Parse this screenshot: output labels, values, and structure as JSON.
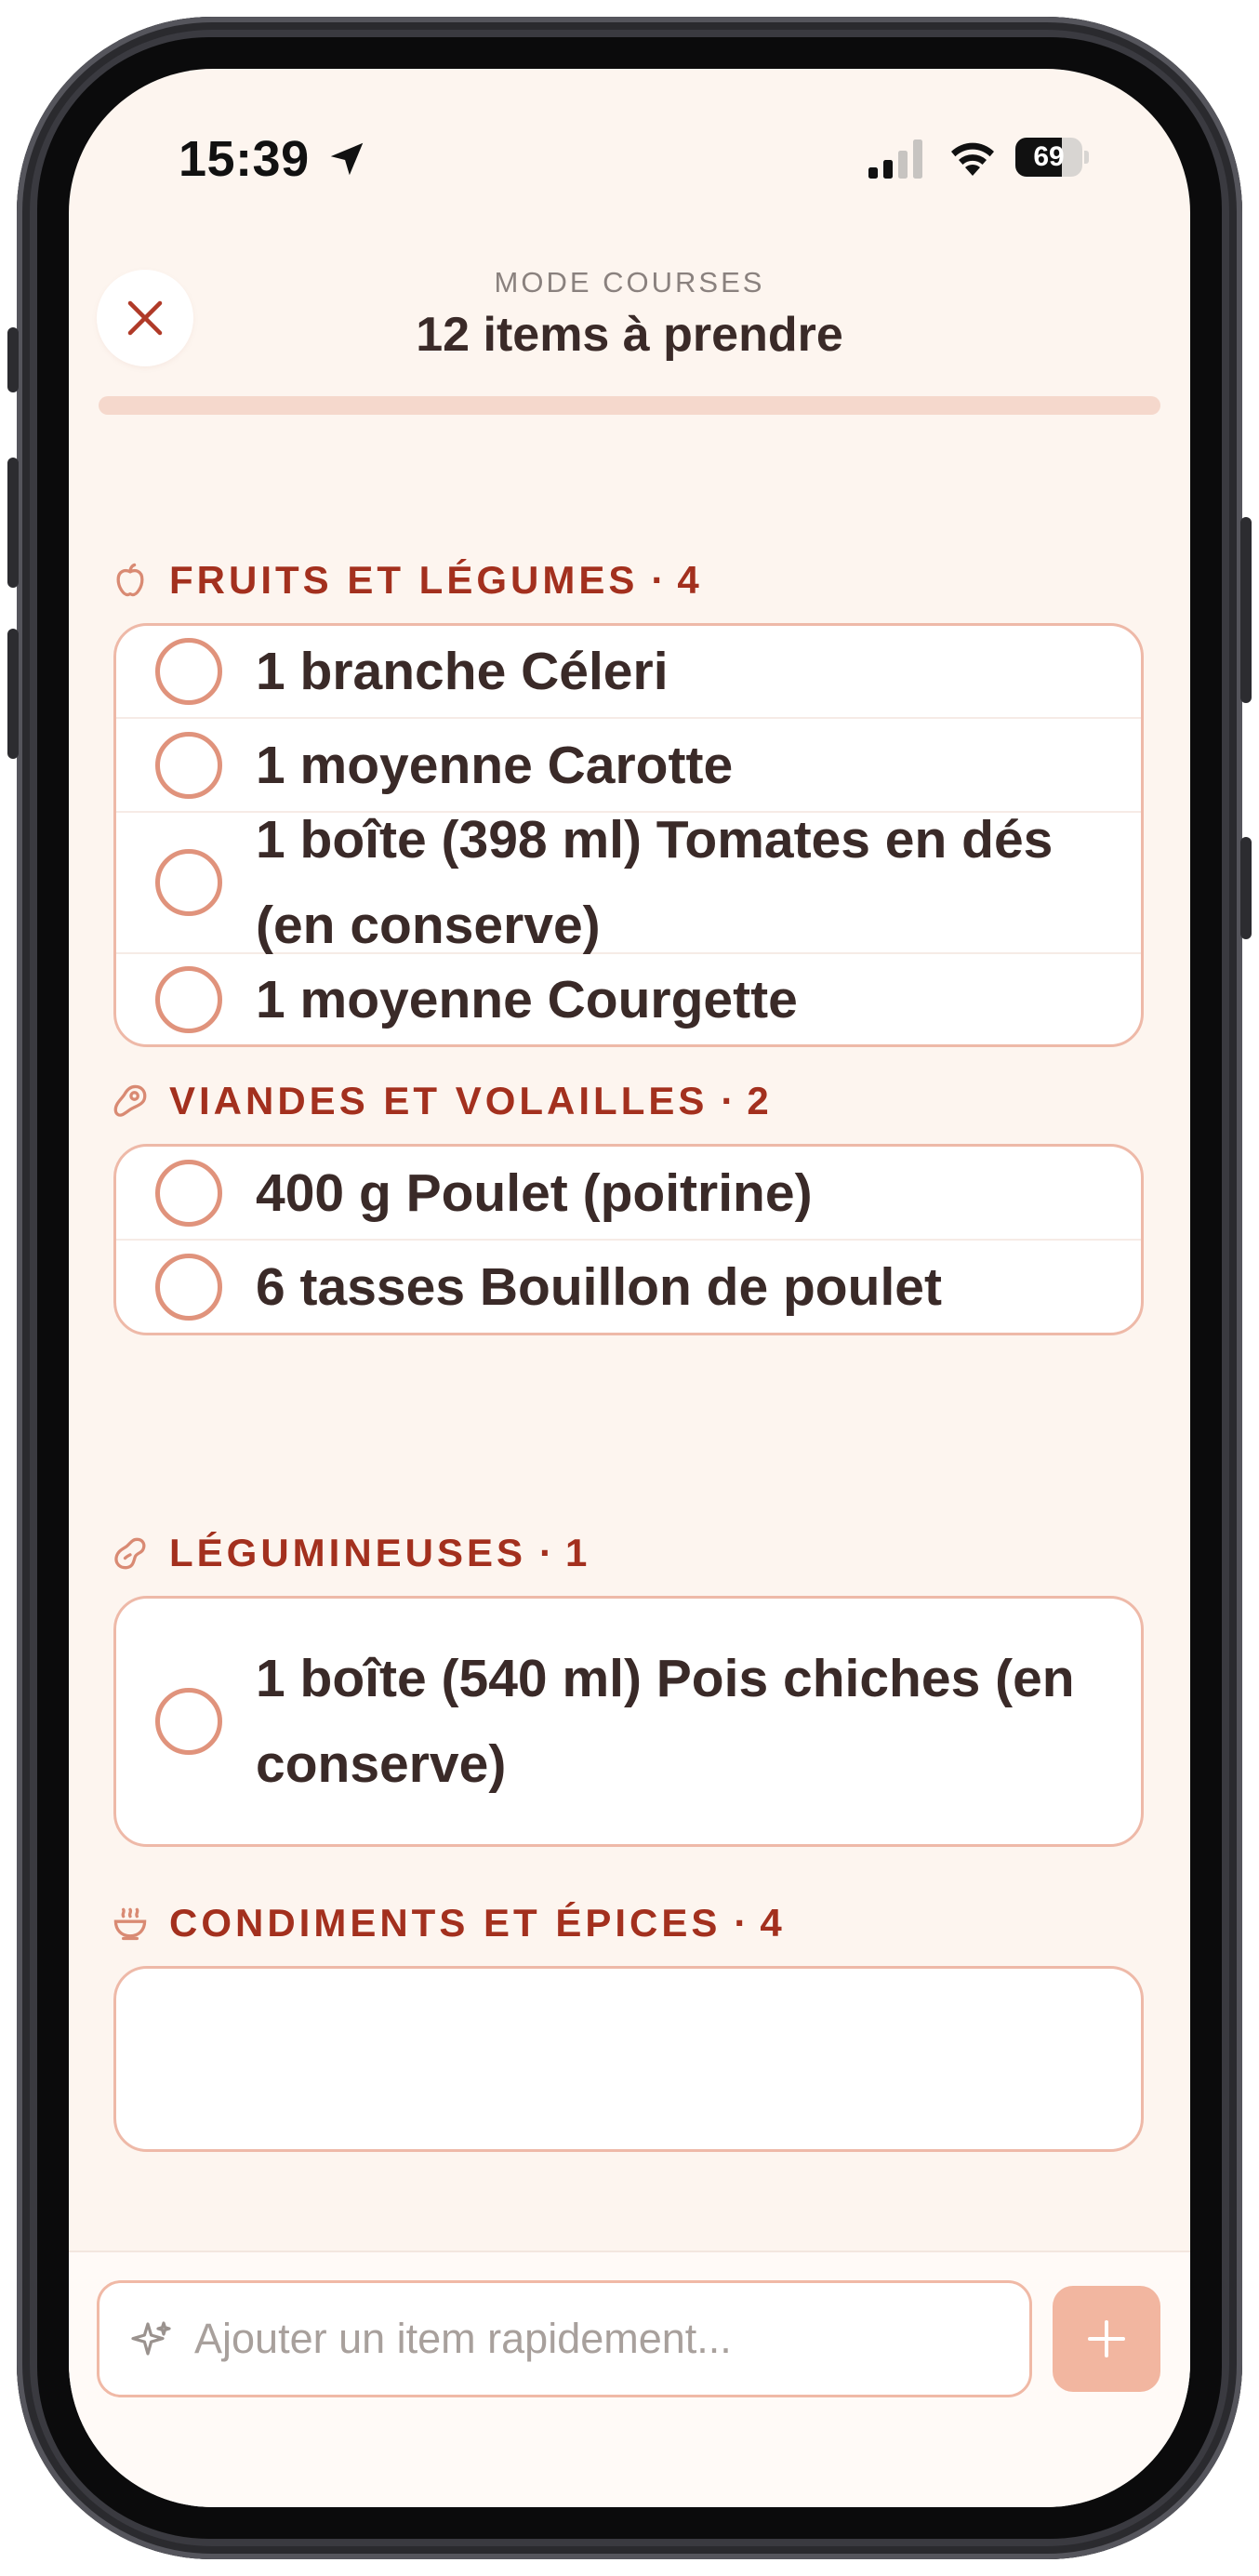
{
  "status_bar": {
    "time": "15:39",
    "battery": "69",
    "battery_level": 0.69,
    "icons": [
      "location-arrow-icon",
      "signal-icon",
      "wifi-icon",
      "battery-icon"
    ]
  },
  "header": {
    "kicker": "MODE COURSES",
    "title": "12 items à prendre",
    "progress": 0,
    "close_icon": "close-icon"
  },
  "sections": [
    {
      "title": "FRUITS ET LÉGUMES",
      "separator": "·",
      "count": "4",
      "icon": "apple-icon",
      "items": [
        {
          "label": "1 branche Céleri"
        },
        {
          "label": "1 moyenne Carotte"
        },
        {
          "label": "1 boîte (398 ml) Tomates en dés (en conserve)"
        },
        {
          "label": "1 moyenne Courgette"
        }
      ]
    },
    {
      "title": "VIANDES ET VOLAILLES",
      "separator": "·",
      "count": "2",
      "icon": "meat-icon",
      "items": [
        {
          "label": "400 g Poulet (poitrine)"
        },
        {
          "label": "6 tasses Bouillon de poulet"
        }
      ]
    },
    {
      "title": "LÉGUMINEUSES",
      "separator": "·",
      "count": "1",
      "icon": "bean-icon",
      "items": [
        {
          "label": "1 boîte (540 ml) Pois chiches (en conserve)"
        }
      ]
    },
    {
      "title": "CONDIMENTS ET ÉPICES",
      "separator": "·",
      "count": "4",
      "icon": "bowl-icon",
      "items": []
    }
  ],
  "quick_add": {
    "placeholder": "Ajouter un item rapidement...",
    "icon": "sparkle-icon",
    "button_icon": "plus-icon"
  },
  "colors": {
    "background": "#fdf5ef",
    "accent": "#a3301e",
    "checkbox": "#e0937c",
    "card_border": "#eeb9a8",
    "add_button": "#f2b6a0"
  }
}
